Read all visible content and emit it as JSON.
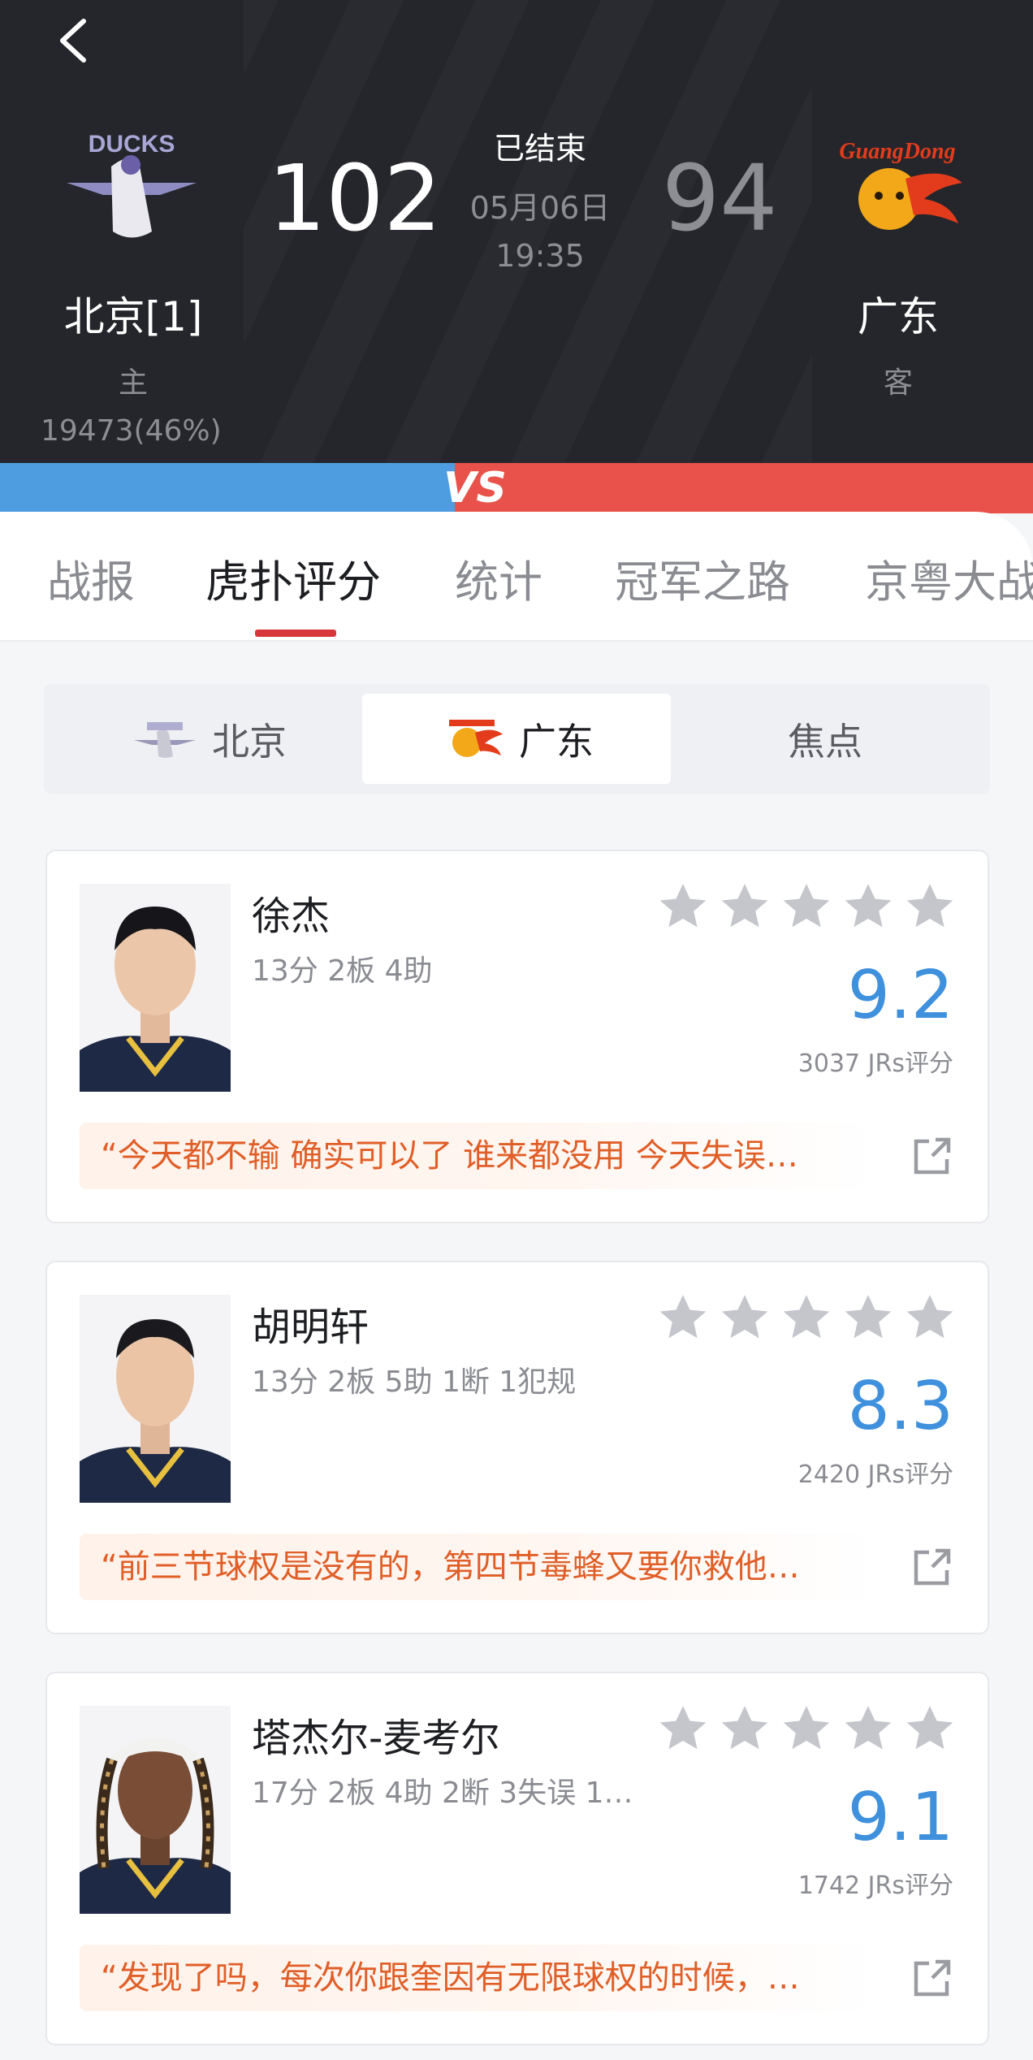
{
  "header": {
    "home": {
      "name": "北京[1]",
      "role": "主",
      "support": "19473(46%)",
      "score": "102",
      "logo_text": "DUCKS"
    },
    "away": {
      "name": "广东",
      "role": "客",
      "score": "94",
      "logo_text": "GuangDong"
    },
    "status": "已结束",
    "date": "05月06日",
    "time": "19:35",
    "vs": "VS"
  },
  "tabs": [
    "战报",
    "虎扑评分",
    "统计",
    "冠军之路",
    "京粤大战"
  ],
  "segments": [
    "北京",
    "广东",
    "焦点"
  ],
  "players": [
    {
      "name": "徐杰",
      "stats": "13分 2板 4助",
      "rating": "9.2",
      "count": "3037 JRs评分",
      "quote": "“今天都不输 确实可以了 谁来都没用 今天失误…"
    },
    {
      "name": "胡明轩",
      "stats": "13分 2板 5助 1断 1犯规",
      "rating": "8.3",
      "count": "2420 JRs评分",
      "quote": "“前三节球权是没有的，第四节毒蜂又要你救他…"
    },
    {
      "name": "塔杰尔-麦考尔",
      "stats": "17分 2板 4助 2断 3失误 1…",
      "rating": "9.1",
      "count": "1742 JRs评分",
      "quote": "“发现了吗，每次你跟奎因有无限球权的时候，…"
    }
  ],
  "colors": {
    "accent_blue": "#3f90dd",
    "accent_red": "#d7363a",
    "quote_orange": "#e05f28"
  }
}
